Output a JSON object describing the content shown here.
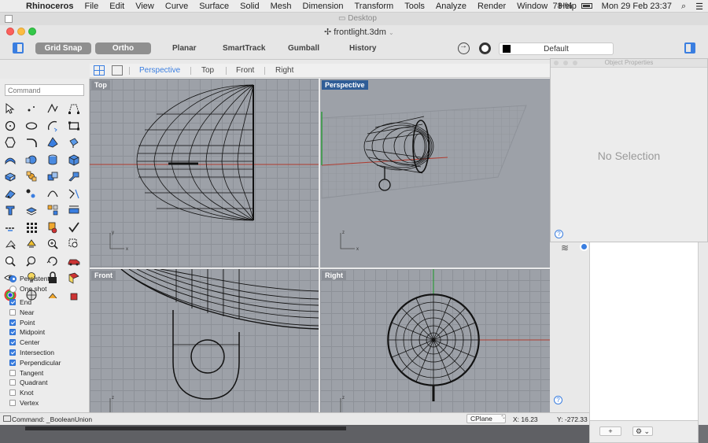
{
  "menubar": {
    "app": "Rhinoceros",
    "items": [
      "File",
      "Edit",
      "View",
      "Curve",
      "Surface",
      "Solid",
      "Mesh",
      "Dimension",
      "Transform",
      "Tools",
      "Analyze",
      "Render",
      "Window",
      "Help"
    ],
    "battery": "78 %",
    "clock": "Mon 29 Feb  23:37"
  },
  "desktop_tab": {
    "label": "Desktop"
  },
  "window": {
    "title": "frontlight.3dm"
  },
  "toolbar": {
    "grid_snap": "Grid Snap",
    "ortho": "Ortho",
    "planar": "Planar",
    "smarttrack": "SmartTrack",
    "gumball": "Gumball",
    "history": "History",
    "layer": "Default",
    "layer_color": "#000000"
  },
  "viewport_tabs": [
    "Perspective",
    "Top",
    "Front",
    "Right"
  ],
  "active_tab": "Perspective",
  "command": {
    "placeholder": "Command"
  },
  "viewports": {
    "top": "Top",
    "perspective": "Perspective",
    "front": "Front",
    "right": "Right"
  },
  "axis_labels": {
    "x": "x",
    "y": "y",
    "z": "z"
  },
  "osnap": {
    "modes": [
      {
        "label": "Persistent",
        "on": true
      },
      {
        "label": "One shot",
        "on": false
      }
    ],
    "snaps": [
      {
        "label": "End",
        "on": true
      },
      {
        "label": "Near",
        "on": false
      },
      {
        "label": "Point",
        "on": true
      },
      {
        "label": "Midpoint",
        "on": true
      },
      {
        "label": "Center",
        "on": true
      },
      {
        "label": "Intersection",
        "on": true
      },
      {
        "label": "Perpendicular",
        "on": true
      },
      {
        "label": "Tangent",
        "on": false
      },
      {
        "label": "Quadrant",
        "on": false
      },
      {
        "label": "Knot",
        "on": false
      },
      {
        "label": "Vertex",
        "on": false
      }
    ]
  },
  "object_properties": {
    "title": "Object Properties",
    "empty": "No Selection"
  },
  "layer_panel": {
    "add": "+",
    "gear": "⚙ ⌄"
  },
  "status": {
    "command": "Command: _BooleanUnion",
    "cplane": "CPlane",
    "x": "X: 16.23",
    "y": "Y: -272.33"
  },
  "colors": {
    "accent": "#3a7ee0",
    "active_viewport": "#2f5d97",
    "x_axis": "#b03a2e",
    "y_axis": "#2e9a3a"
  }
}
